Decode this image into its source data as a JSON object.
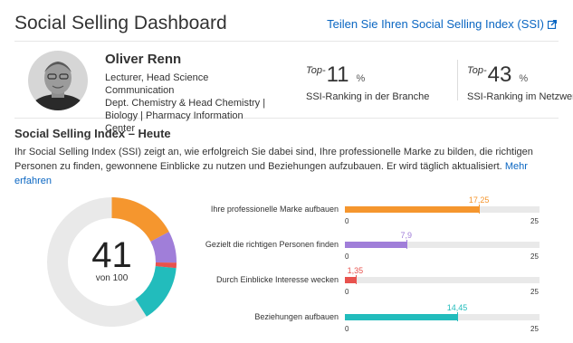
{
  "header": {
    "title": "Social Selling Dashboard",
    "share_label": "Teilen Sie Ihren Social Selling Index (SSI)"
  },
  "profile": {
    "name": "Oliver Renn",
    "headline_lines": [
      "Lecturer, Head Science Communication",
      "Dept. Chemistry & Head Chemistry |",
      "Biology | Pharmacy Information Center"
    ]
  },
  "rankings": [
    {
      "prefix": "Top-",
      "value": "11",
      "unit": "%",
      "label": "SSI-Ranking in der Branche"
    },
    {
      "prefix": "Top-",
      "value": "43",
      "unit": "%",
      "label": "SSI-Ranking im Netzwerk"
    }
  ],
  "index": {
    "title": "Social Selling Index – Heute",
    "description": "Ihr Social Selling Index (SSI) zeigt an, wie erfolgreich Sie dabei sind, Ihre professionelle Marke zu bilden, die richtigen Personen zu finden, gewonnene Einblicke zu nutzen und Beziehungen aufzubauen. Er wird täglich aktualisiert.",
    "more_label": "Mehr erfahren",
    "score": "41",
    "score_sub": "von 100",
    "score_max": 100
  },
  "chart_data": {
    "type": "bar",
    "categories": [
      "Ihre professionelle Marke aufbauen",
      "Gezielt die richtigen Personen finden",
      "Durch Einblicke Interesse wecken",
      "Beziehungen aufbauen"
    ],
    "values": [
      17.25,
      7.9,
      1.35,
      14.45
    ],
    "value_labels": [
      "17,25",
      "7,9",
      "1,35",
      "14,45"
    ],
    "colors": [
      "#f5962e",
      "#a07ed9",
      "#e8524e",
      "#22bcbc"
    ],
    "xlim": [
      0,
      25
    ],
    "tick_labels": [
      "0",
      "25"
    ],
    "track_color": "#e9e9e9"
  }
}
